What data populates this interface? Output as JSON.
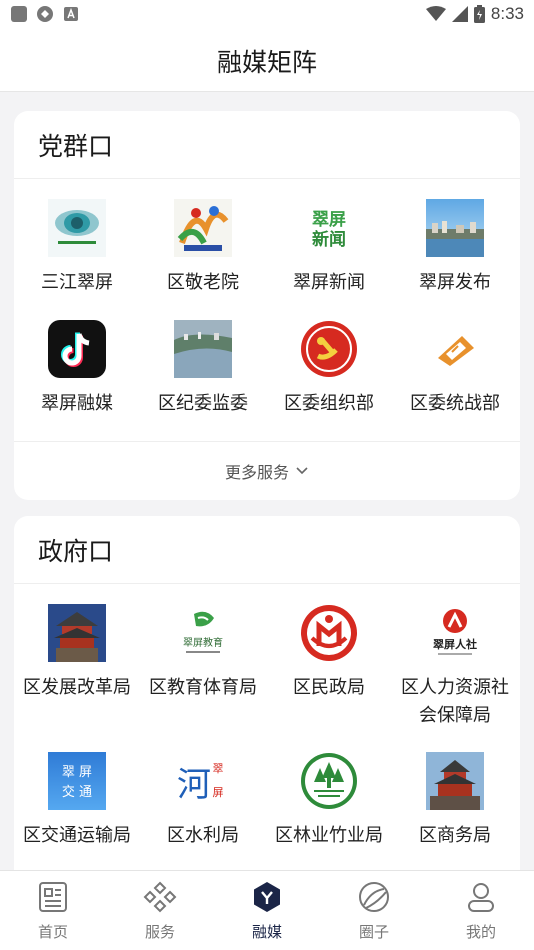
{
  "status_bar": {
    "time": "8:33"
  },
  "header": {
    "title": "融媒矩阵"
  },
  "sections": [
    {
      "title": "党群口",
      "items": [
        {
          "label": "三江翠屏",
          "icon": "sanjiang-cuiping-logo"
        },
        {
          "label": "区敬老院",
          "icon": "nursing-home-logo"
        },
        {
          "label": "翠屏新闻",
          "icon": "cuiping-news-logo",
          "icon_text": [
            "翠屏",
            "新闻"
          ]
        },
        {
          "label": "翠屏发布",
          "icon": "city-photo"
        },
        {
          "label": "翠屏融媒",
          "icon": "tiktok-logo"
        },
        {
          "label": "区纪委监委",
          "icon": "river-town-photo"
        },
        {
          "label": "区委组织部",
          "icon": "party-emblem"
        },
        {
          "label": "区委统战部",
          "icon": "united-front-logo"
        }
      ],
      "more_label": "更多服务"
    },
    {
      "title": "政府口",
      "items": [
        {
          "label": "区发展改革局",
          "icon": "tower-photo"
        },
        {
          "label": "区教育体育局",
          "icon": "education-logo",
          "icon_text": "翠屏教育"
        },
        {
          "label": "区民政局",
          "icon": "civil-affairs-logo"
        },
        {
          "label": "区人力资源社会保障局",
          "label_lines": [
            "区人力资源社",
            "会保障局"
          ],
          "icon": "hr-logo",
          "icon_text": "翠屏人社"
        },
        {
          "label": "区交通运输局",
          "icon": "transport-logo",
          "icon_text": [
            "翠 屏",
            "交 通"
          ]
        },
        {
          "label": "区水利局",
          "icon": "water-logo",
          "icon_text": [
            "河",
            "翠",
            "屏"
          ]
        },
        {
          "label": "区林业竹业局",
          "icon": "forestry-logo"
        },
        {
          "label": "区商务局",
          "icon": "commerce-tower-photo"
        }
      ]
    }
  ],
  "tabs": [
    {
      "label": "首页",
      "icon": "newspaper-icon"
    },
    {
      "label": "服务",
      "icon": "diamonds-icon"
    },
    {
      "label": "融媒",
      "icon": "rongmei-hexagon-icon",
      "active": true
    },
    {
      "label": "圈子",
      "icon": "circle-orbit-icon"
    },
    {
      "label": "我的",
      "icon": "user-icon"
    }
  ],
  "colors": {
    "accent": "#1b2547",
    "party_red": "#d62a20",
    "brand_green": "#2e8b3a"
  }
}
